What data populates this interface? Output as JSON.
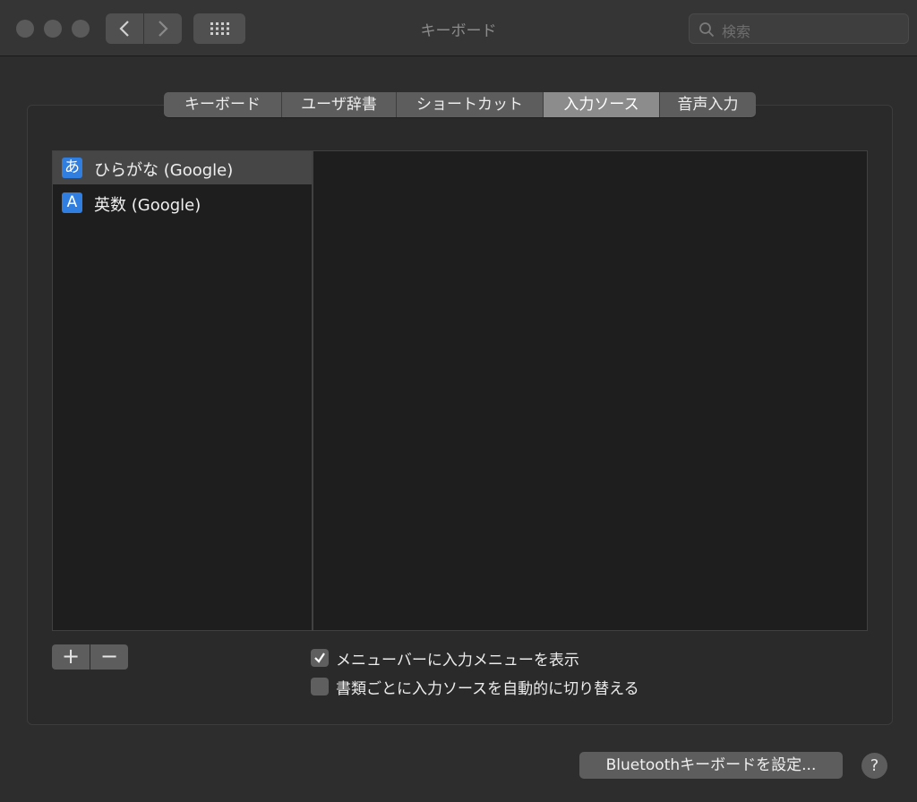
{
  "window": {
    "title": "キーボード"
  },
  "toolbar": {
    "back_icon": "chevron-left-icon",
    "forward_icon": "chevron-right-icon",
    "grid_icon": "grid-icon"
  },
  "search": {
    "placeholder": "検索",
    "value": ""
  },
  "tabs": [
    {
      "label": "キーボード",
      "active": false
    },
    {
      "label": "ユーザ辞書",
      "active": false
    },
    {
      "label": "ショートカット",
      "active": false
    },
    {
      "label": "入力ソース",
      "active": true
    },
    {
      "label": "音声入力",
      "active": false
    }
  ],
  "input_sources": [
    {
      "icon_char": "あ",
      "label": "ひらがな (Google)",
      "selected": true
    },
    {
      "icon_char": "A",
      "label": "英数 (Google)",
      "selected": false
    }
  ],
  "list_controls": {
    "add": "+",
    "remove": "−"
  },
  "options": [
    {
      "label": "メニューバーに入力メニューを表示",
      "checked": true
    },
    {
      "label": "書類ごとに入力ソースを自動的に切り替える",
      "checked": false
    }
  ],
  "bottom": {
    "bluetooth_button": "Bluetoothキーボードを設定...",
    "help": "?"
  },
  "colors": {
    "accent": "#2f7ee0",
    "window_bg": "#2d2d2d",
    "selected_tab": "#8c8c8c"
  }
}
